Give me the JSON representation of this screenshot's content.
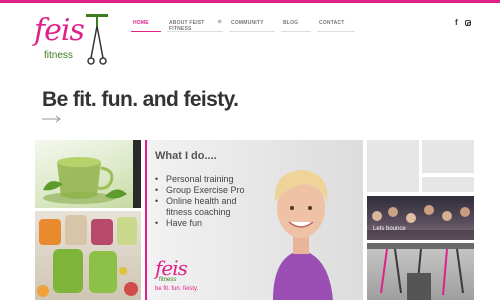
{
  "brand": {
    "logo_name": "feis",
    "logo_sub": "fitness",
    "accent": "#e0218a",
    "green": "#3a7d1e"
  },
  "nav": {
    "items": [
      {
        "label": "HOME",
        "active": true
      },
      {
        "label": "ABOUT FEIST FITNESS",
        "has_dropdown": true
      },
      {
        "label": "COMMUNITY"
      },
      {
        "label": "BLOG"
      },
      {
        "label": "CONTACT"
      }
    ]
  },
  "social": {
    "facebook_glyph": "f",
    "icons": [
      "facebook-icon",
      "instagram-icon"
    ]
  },
  "hero": {
    "tagline": "Be fit. fun. and feisty."
  },
  "promo": {
    "title": "What I do....",
    "items": [
      "Personal training",
      "Group Exercise Pro",
      "Online health and",
      "fitness coaching",
      "Have fun"
    ],
    "logo_name": "feis",
    "logo_sub": "fitness",
    "logo_tagline": "be fit. fun. feisty."
  },
  "tiles": {
    "group_label": "Lets bounce"
  }
}
